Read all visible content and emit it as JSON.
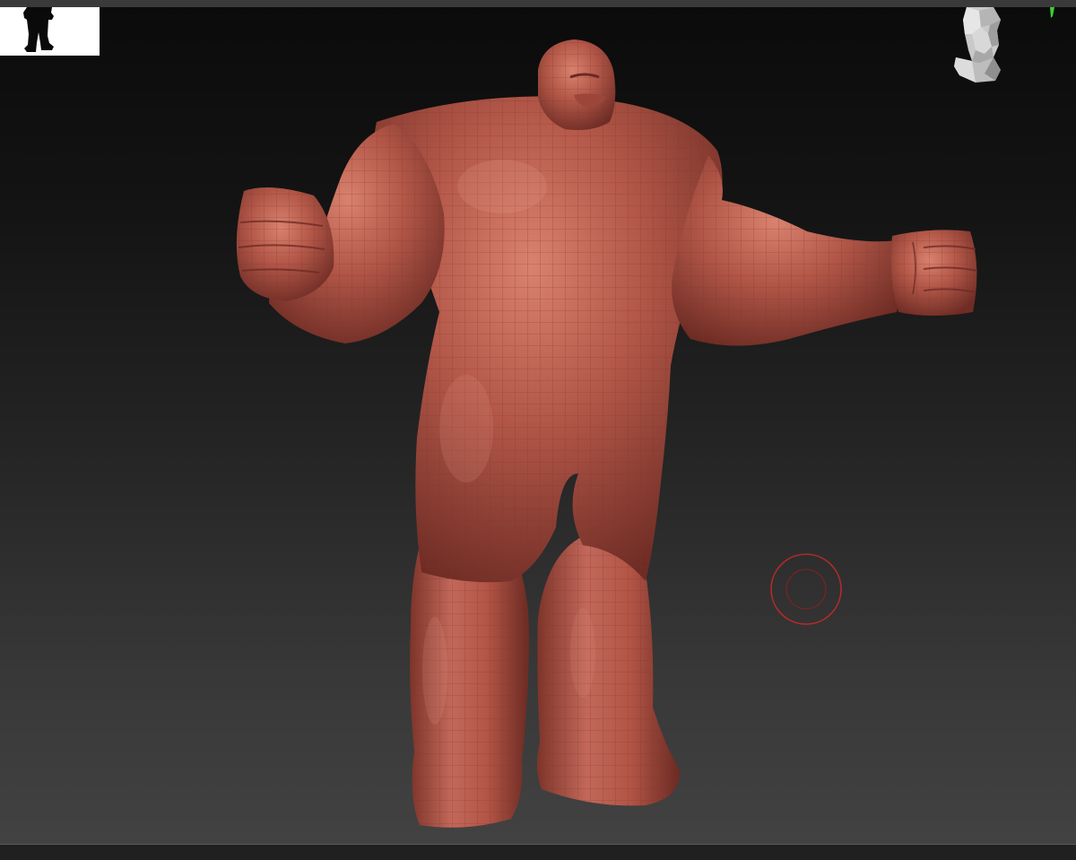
{
  "app": {
    "viewport_label": "",
    "model_color": "#b3584a",
    "wire_color": "#8a3a2f",
    "brush_cursor_color": "#b52a2a",
    "accent_marker_color": "#39d22e",
    "background_top": "#0b0b0b",
    "background_bottom": "#424242"
  },
  "icons": {
    "silhouette": "silhouette-thumbnail-icon",
    "navigation_head": "navigation-head-icon",
    "brush_cursor": "brush-cursor-icon",
    "marker": "green-marker-icon"
  }
}
